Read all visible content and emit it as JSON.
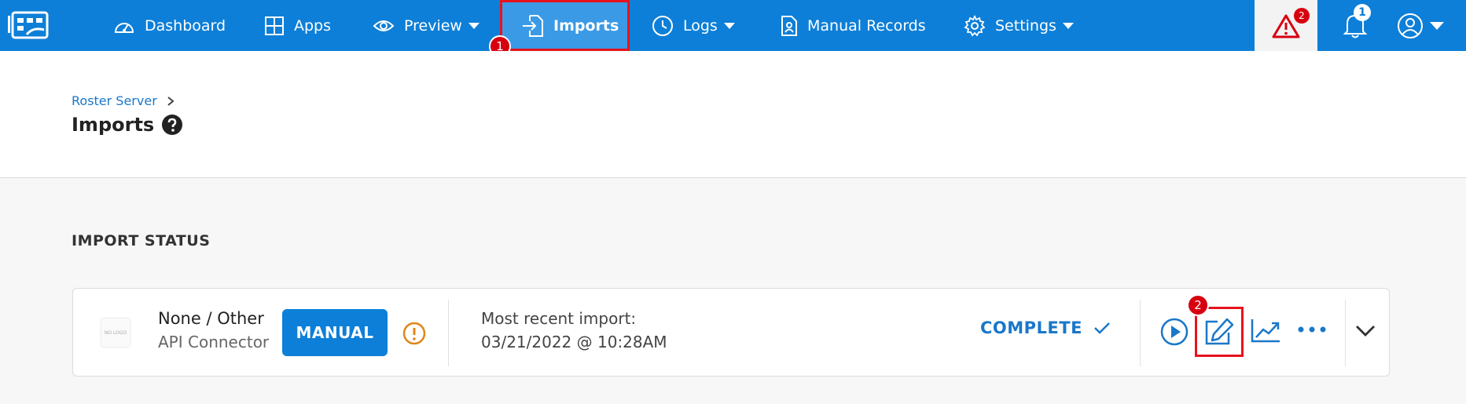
{
  "nav": {
    "items": [
      {
        "label": "Dashboard",
        "icon": "speedometer-icon"
      },
      {
        "label": "Apps",
        "icon": "grid-icon"
      },
      {
        "label": "Preview",
        "icon": "eye-icon"
      },
      {
        "label": "Imports",
        "icon": "import-icon"
      },
      {
        "label": "Logs",
        "icon": "clock-icon"
      },
      {
        "label": "Manual Records",
        "icon": "person-document-icon"
      },
      {
        "label": "Settings",
        "icon": "gear-icon"
      }
    ],
    "active": "Imports",
    "alert_count": "2",
    "notification_count": "1"
  },
  "steps": [
    "1",
    "2"
  ],
  "breadcrumb": {
    "parent": "Roster Server"
  },
  "page": {
    "title": "Imports"
  },
  "section": {
    "title": "IMPORT STATUS"
  },
  "import_card": {
    "logo_text": "NO LOGO",
    "source_name": "None / Other",
    "source_type": "API Connector",
    "mode_label": "MANUAL",
    "recent_label": "Most recent import:",
    "recent_value": "03/21/2022 @ 10:28AM",
    "status": "COMPLETE"
  },
  "colors": {
    "brand": "#0d7fd8",
    "highlight": "#e8121c",
    "warning": "#e0861a",
    "link": "#1a77c9"
  }
}
